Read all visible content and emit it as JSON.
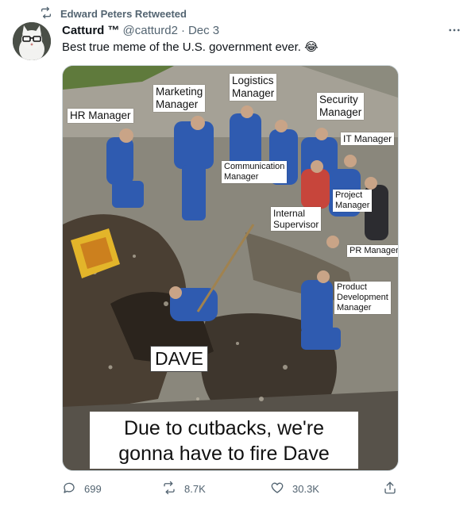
{
  "retweet_banner": {
    "text": "Edward Peters Retweeted",
    "icon": "retweet-icon"
  },
  "author": {
    "name": "Catturd ™",
    "handle": "@catturd2",
    "separator": "·",
    "date": "Dec 3"
  },
  "tweet": {
    "text": "Best true meme of the U.S. government ever. 😂"
  },
  "meme": {
    "labels": {
      "hr": "HR Manager",
      "marketing": "Marketing\nManager",
      "logistics": "Logistics\nManager",
      "security": "Security\nManager",
      "it": "IT Manager",
      "communication": "Communication\nManager",
      "project": "Project\nManager",
      "internal": "Internal\nSupervisor",
      "pr": "PR Manager",
      "product": "Product\nDevelopment\nManager",
      "dave": "DAVE"
    },
    "caption_line1": "Due to cutbacks, we're",
    "caption_line2": "gonna have to fire Dave"
  },
  "actions": {
    "replies": "699",
    "retweets": "8.7K",
    "likes": "30.3K"
  },
  "colors": {
    "secondary_text": "#536471",
    "primary_text": "#0f1419",
    "border": "#cfd9de"
  }
}
